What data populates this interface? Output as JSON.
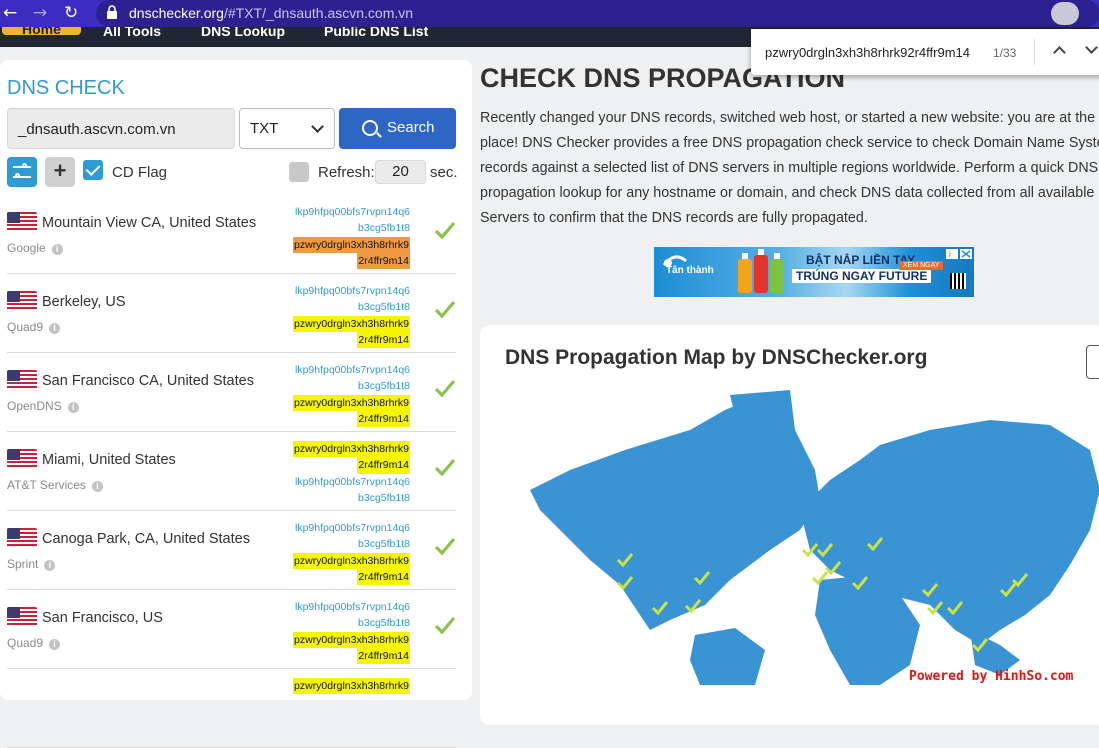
{
  "browser": {
    "url_host": "dnschecker.org",
    "url_path": "/#TXT/_dnsauth.ascvn.com.vn"
  },
  "menu": [
    "Home",
    "All Tools",
    "DNS Lookup",
    "Public DNS List"
  ],
  "find_bar": {
    "query": "pzwry0drgln3xh3h8rhrk92r4ffr9m14",
    "count": "1/33"
  },
  "left": {
    "title": "DNS CHECK",
    "domain": "_dnsauth.ascvn.com.vn",
    "record_type": "TXT",
    "search_label": "Search",
    "cd_flag_label": "CD Flag",
    "refresh_label": "Refresh:",
    "refresh_value": "20",
    "sec_label": "sec."
  },
  "results": [
    {
      "location": "Mountain View CA, United States",
      "provider": "Google",
      "records": [
        {
          "t": "lkp9hfpq00bfs7rvpn14q6",
          "h": "none"
        },
        {
          "t": "b3cg5fb1t8",
          "h": "none"
        },
        {
          "t": "pzwry0drgln3xh3h8rhrk9",
          "h": "orange"
        },
        {
          "t": "2r4ffr9m14",
          "h": "orange"
        }
      ]
    },
    {
      "location": "Berkeley, US",
      "provider": "Quad9",
      "records": [
        {
          "t": "lkp9hfpq00bfs7rvpn14q6",
          "h": "none"
        },
        {
          "t": "b3cg5fb1t8",
          "h": "none"
        },
        {
          "t": "pzwry0drgln3xh3h8rhrk9",
          "h": "yellow"
        },
        {
          "t": "2r4ffr9m14",
          "h": "yellow"
        }
      ]
    },
    {
      "location": "San Francisco CA, United States",
      "provider": "OpenDNS",
      "records": [
        {
          "t": "lkp9hfpq00bfs7rvpn14q6",
          "h": "none"
        },
        {
          "t": "b3cg5fb1t8",
          "h": "none"
        },
        {
          "t": "pzwry0drgln3xh3h8rhrk9",
          "h": "yellow"
        },
        {
          "t": "2r4ffr9m14",
          "h": "yellow"
        }
      ]
    },
    {
      "location": "Miami, United States",
      "provider": "AT&T Services",
      "records": [
        {
          "t": "pzwry0drgln3xh3h8rhrk9",
          "h": "yellow"
        },
        {
          "t": "2r4ffr9m14",
          "h": "yellow"
        },
        {
          "t": "lkp9hfpq00bfs7rvpn14q6",
          "h": "none"
        },
        {
          "t": "b3cg5fb1t8",
          "h": "none"
        }
      ]
    },
    {
      "location": "Canoga Park, CA, United States",
      "provider": "Sprint",
      "records": [
        {
          "t": "lkp9hfpq00bfs7rvpn14q6",
          "h": "none"
        },
        {
          "t": "b3cg5fb1t8",
          "h": "none"
        },
        {
          "t": "pzwry0drgln3xh3h8rhrk9",
          "h": "yellow"
        },
        {
          "t": "2r4ffr9m14",
          "h": "yellow"
        }
      ]
    },
    {
      "location": "San Francisco, US",
      "provider": "Quad9",
      "records": [
        {
          "t": "lkp9hfpq00bfs7rvpn14q6",
          "h": "none"
        },
        {
          "t": "b3cg5fb1t8",
          "h": "none"
        },
        {
          "t": "pzwry0drgln3xh3h8rhrk9",
          "h": "yellow"
        },
        {
          "t": "2r4ffr9m14",
          "h": "yellow"
        }
      ]
    },
    {
      "location": "",
      "provider": "",
      "records": [
        {
          "t": "pzwry0drgln3xh3h8rhrk9",
          "h": "yellow"
        }
      ]
    }
  ],
  "right": {
    "title": "CHECK DNS PROPAGATION",
    "paragraph": "Recently changed your DNS records, switched web host, or started a new website: you are at the rig\nplace! DNS Checker provides a free DNS propagation check service to check Domain Name System\nrecords against a selected list of DNS servers in multiple regions worldwide. Perform a quick DNS\npropagation lookup for any hostname or domain, and check DNS data collected from all available DN\nServers to confirm that the DNS records are fully propagated.",
    "ad": {
      "brand": "Tân thành",
      "line1": "BẬT NẮP LIỀN TAY",
      "line2": "TRÚNG NGAY FUTURE",
      "cta": "XEM NGAY"
    },
    "map_title": "DNS Propagation Map by DNSChecker.org"
  },
  "colors": {
    "accent": "#2f9bd4",
    "button": "#2d66c4",
    "ok": "#8bc34a",
    "map": "#3a93d3",
    "highlight": "#f5f500",
    "active_highlight": "#ef9a42"
  },
  "watermark": "Powered by HinhSo.com"
}
